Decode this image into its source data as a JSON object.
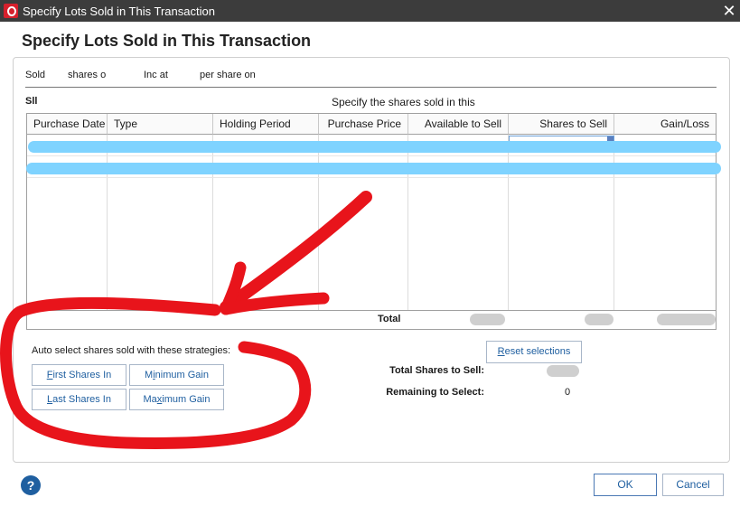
{
  "window": {
    "title": "Specify Lots Sold in This Transaction",
    "close_glyph": "✕",
    "app_icon": "quicken-logo-icon"
  },
  "dialog": {
    "heading": "Specify Lots Sold in This Transaction"
  },
  "info": {
    "sold": "Sold",
    "shares_of": "shares o",
    "inc_at": "Inc at",
    "per_share_on": "per share on"
  },
  "sell_label": "Sll",
  "specify_label": "Specify the shares sold in this",
  "grid": {
    "columns": [
      "Purchase Date",
      "Type",
      "Holding Period",
      "Purchase Price",
      "Available to Sell",
      "Shares to Sell",
      "Gain/Loss"
    ],
    "total_label": "Total"
  },
  "auto_select": {
    "label": "Auto select shares sold with these strategies:",
    "first_shares_in": {
      "hot": "F",
      "rest": "irst Shares In"
    },
    "minimum_gain": {
      "pre": "M",
      "hot": "i",
      "rest": "nimum Gain"
    },
    "last_shares_in": {
      "hot": "L",
      "rest": "ast Shares In"
    },
    "maximum_gain": {
      "pre": "Ma",
      "hot": "x",
      "rest": "imum Gain"
    }
  },
  "reset": {
    "hot": "R",
    "rest": "eset selections"
  },
  "totals": {
    "total_shares_label": "Total Shares to Sell:",
    "remaining_label": "Remaining to Select:",
    "remaining_value": "0"
  },
  "footer": {
    "help_glyph": "?",
    "ok": "OK",
    "cancel": "Cancel"
  },
  "colors": {
    "titlebar": "#3c3c3c",
    "brand": "#d6202c",
    "link_blue": "#1f5fa0",
    "redaction": "#7fd3ff",
    "annotation_red": "#e8141b"
  },
  "icons": [
    "quicken-logo-icon",
    "close-icon",
    "help-icon",
    "spin-icon"
  ]
}
